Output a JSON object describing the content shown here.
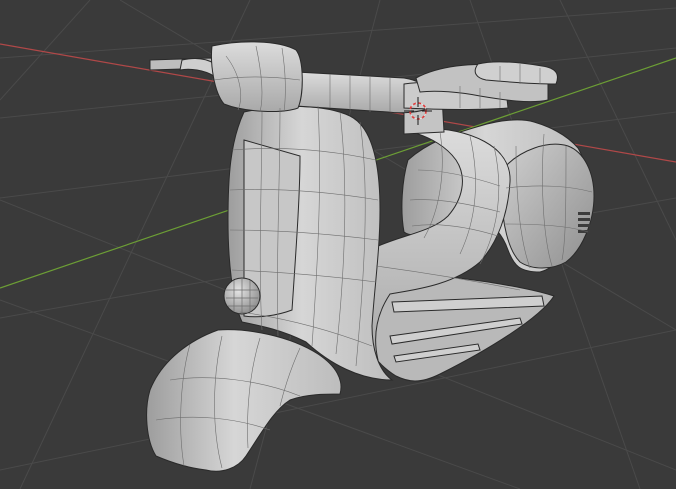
{
  "viewport": {
    "kind": "3d-viewport",
    "background_color": "#3a3a3a",
    "grid_color": "#4a4a4a",
    "x_axis_color": "#b04848",
    "y_axis_color": "#6c9e35",
    "model": {
      "name": "vespa-scooter-wireframe",
      "surface_color": "#d4d4d4",
      "wire_color": "#6e6e6e",
      "edge_color": "#2a2a2a"
    },
    "cursor_3d": {
      "icon": "3d-cursor-icon",
      "ring_color": "#e23a3a"
    }
  }
}
